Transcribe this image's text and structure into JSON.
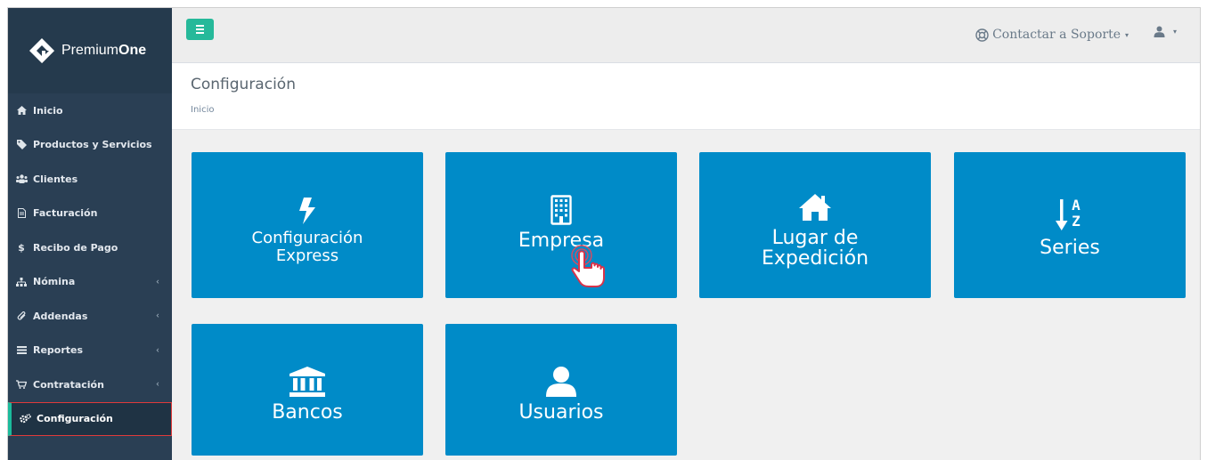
{
  "brand": {
    "name_light": "Premium",
    "name_bold": "One"
  },
  "sidebar": {
    "items": [
      {
        "label": "Inicio",
        "icon": "home-icon",
        "chevron": ""
      },
      {
        "label": "Productos y Servicios",
        "icon": "tag-icon",
        "chevron": ""
      },
      {
        "label": "Clientes",
        "icon": "users-icon",
        "chevron": ""
      },
      {
        "label": "Facturación",
        "icon": "file-icon",
        "chevron": ""
      },
      {
        "label": "Recibo de Pago",
        "icon": "dollar-icon",
        "chevron": ""
      },
      {
        "label": "Nómina",
        "icon": "sitemap-icon",
        "chevron": "‹"
      },
      {
        "label": "Addendas",
        "icon": "paperclip-icon",
        "chevron": "‹"
      },
      {
        "label": "Reportes",
        "icon": "list-icon",
        "chevron": "‹"
      },
      {
        "label": "Contratación",
        "icon": "cart-icon",
        "chevron": "‹"
      },
      {
        "label": "Configuración",
        "icon": "cogs-icon",
        "chevron": ""
      }
    ],
    "active": "Configuración"
  },
  "topbar": {
    "support_label": "Contactar a Soporte",
    "caret": "▾"
  },
  "page": {
    "title": "Configuración",
    "breadcrumb": "Inicio"
  },
  "tiles": [
    {
      "label": "Configuración\nExpress",
      "icon": "bolt-icon"
    },
    {
      "label": "Empresa",
      "icon": "building-icon"
    },
    {
      "label": "Lugar de\nExpedición",
      "icon": "home-icon"
    },
    {
      "label": "Series",
      "icon": "sort-alpha-icon"
    },
    {
      "label": "Bancos",
      "icon": "bank-icon"
    },
    {
      "label": "Usuarios",
      "icon": "user-icon"
    }
  ],
  "colors": {
    "sidebar": "#2a3f54",
    "tile": "#008bc8",
    "accent": "#26b99a",
    "active_border": "#e03a3a"
  }
}
